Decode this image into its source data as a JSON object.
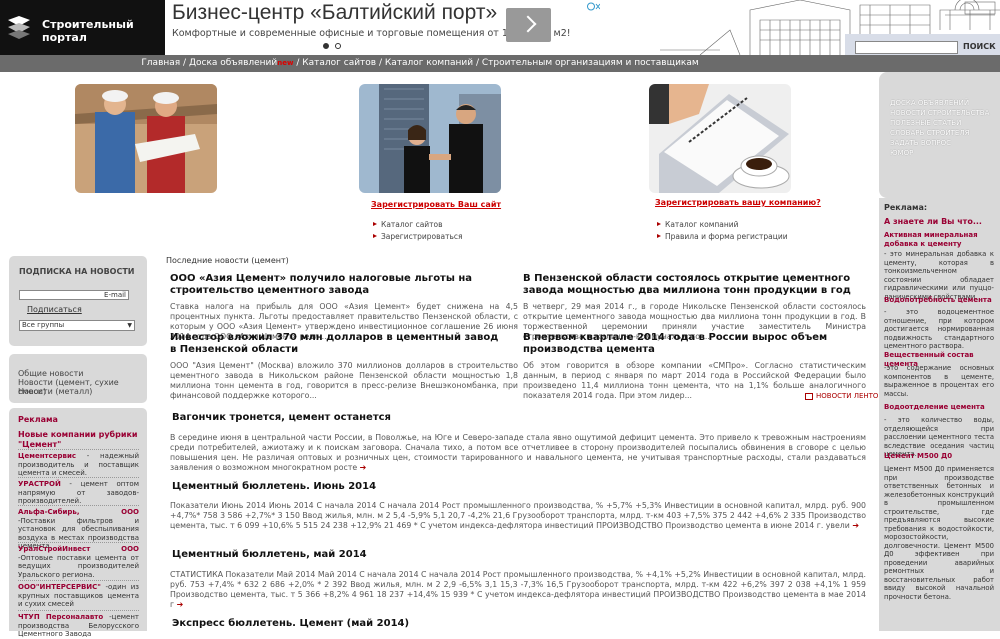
{
  "header": {
    "logo_text": "Строительный портал",
    "ad_title": "Бизнес-центр «Балтийский порт»",
    "ad_subtitle": "Комфортные и современные офисные и торговые помещения от 10 до 250 м2!",
    "search_button": "ПОИСК"
  },
  "nav": {
    "items": [
      "Главная",
      "Доска объявлений",
      "Каталог сайтов",
      "Каталог компаний",
      "Строительным организациям и поставщикам"
    ],
    "new_badge": "new"
  },
  "promo": {
    "sites_title": "Зарегистрировать Ваш сайт",
    "sites_links": [
      "Каталог сайтов",
      "Зарегистрироваться"
    ],
    "company_title": "Зарегистрировать вашу компанию?",
    "company_links": [
      "Каталог компаний",
      "Правила и форма регистрации"
    ]
  },
  "subscribe": {
    "title": "ПОДПИСКА НА НОВОСТИ",
    "email_placeholder": "E-mail",
    "subscribe_link": "Подписаться",
    "group_select": "Все группы"
  },
  "news_groups": [
    "Общие новости",
    "Новости (цемент, сухие смеси)",
    "Новости (металл)"
  ],
  "advert": {
    "title": "Реклама",
    "rubric": "Новые компании рубрики \"Цемент\"",
    "companies": [
      {
        "name": "Цементсервис",
        "text": " - надежный производитель и поставщик цемента и смесей."
      },
      {
        "name": "УРАСТРОЙ",
        "text": " - цемент оптом напрямую от заводов-производителей."
      },
      {
        "name": "Альфа-Сибирь, ООО",
        "text": " -Поставки фильтров и установок для обеспыливания воздуха в местах производства цемента."
      },
      {
        "name": "УралСтройИнвест ООО",
        "text": " -Оптовые поставки цемента от ведущих производителей Уральского региона."
      },
      {
        "name": "ООО\"ИНТЕРСЕРВИС\"",
        "text": " -один из крупных поставщиков цемента и сухих смесей"
      },
      {
        "name": "ЧТУП Персоналавто",
        "text": " -цемент производства Белорусского Цементного Завода"
      }
    ]
  },
  "right_menu": [
    "ДОСКА ОБЪЯВЛЕНИЙ",
    "НОВОСТИ СТРОИТЕЛЬСТВА",
    "ПОЛЕЗНЫЕ СТАТЬИ",
    "СЛОВАРЬ СТРОИТЕЛЯ",
    "ЗАДАТЬ ВОПРОС",
    "ЮМОР"
  ],
  "right_ads": {
    "title": "Реклама:",
    "question": "А знаете ли Вы что...",
    "terms": [
      {
        "term": "Активная минеральная добавка к цементу",
        "def": "- это минеральная добавка к цементу, которая в тонкоизмельченном состоянии обладает гидравлическими или пуццо-ланическими свойствами."
      },
      {
        "term": "Водопотребность цемента",
        "def": "- это водоцементное отношение, при котором достигается нормированная подвижность стандартного цементного раствора."
      },
      {
        "term": "Вещественный состав цемента",
        "def": "-это содержание основных компонентов в цементе, выраженное в процентах его массы."
      },
      {
        "term": "Водоотделение цемента",
        "def": "- это количество воды, отделяющейся при расслоении цементного теста вследствие оседания частиц цемента."
      },
      {
        "term": "Цемент М500 Д0",
        "def": "Цемент М500 Д0 применяется при производстве ответственных бетонных и железобетонных конструкций в промышленном строительстве, где предъявляются высокие требования к водостойкости, морозостойкости, долговечности. Цемент М500 Д0 эффективен при проведении аварийных ремонтных и восстановительных работ ввиду высокой начальной прочности бетона."
      }
    ]
  },
  "latest_label": "Последние новости (цемент)",
  "all_news": "НОВОСТИ ЛЕНТОЙ",
  "news": [
    {
      "title": "ООО «Азия Цемент» получило налоговые льготы на строительство цементного завода",
      "text": "Ставка налога на прибыль для ООО «Азия Цемент» будет снижена на 4,5 процентных пункта. Льготы предоставляет правительство Пензенской области, с которым у ООО «Азия Цемент» утверждено инвестиционное соглашение 26 июня 2014 года ООО «Азия Цемент» реал..."
    },
    {
      "title": "В Пензенской области состоялось открытие цементного завода мощностью два миллиона тонн продукции в год",
      "text": "В четверг, 29 мая 2014 г., в городе Никольске Пензенской области состоялось открытие цементного завода мощностью два миллиона тонн продукции в год. В торжественной церемонии приняли участие заместитель Министра строительства и жилищно-коммунального ..."
    },
    {
      "title": "Инвестор вложил 370 млн долларов в цементный завод в Пензенской области",
      "text": "ООО \"Азия Цемент\" (Москва) вложило 370 миллионов долларов в строительство цементного завода в Никольском районе Пензенской области мощностью 1,8 миллиона тонн цемента в год, говорится в пресс-релизе Внешэкономбанка, при финансовой поддержке которого..."
    },
    {
      "title": "В первом квартале 2014 года в России вырос объем производства цемента",
      "text": "Об этом говорится в обзоре компании «СМПро». Согласно статистическим данным, в период с января по март 2014 года в Российской Федерации было произведено 11,4 миллиона тонн цемента, что на 1,1% больше аналогичного показателя 2014 года. При этом лидер..."
    }
  ],
  "articles": [
    {
      "title": "Вагончик тронется, цемент останется",
      "text": "В середине июня в центральной части России, в Поволжье, на Юге и Северо-западе стала явно ощутимой дефицит цемента. Это привело к тревожным настроениям среди потребителей, ажиотажу и к поискам заговора. Сначала тихо, а потом все отчетливее в сторону производителей посыпались обвинения в сговоре с целью повышения цен. Не различая оптовых и розничных цен, стоимости тарированного и навального цемента, не учитывая транспортные расходы, стали раздаваться заявления о возможном многократном росте"
    },
    {
      "title": "Цементный бюллетень. Июнь 2014",
      "text": "Показатели Июнь 2014 Июнь 2014 С начала 2014 С начала 2014 Рост промышленного производства, %    +5,7%        +5,3%    Инвестиции в основной капитал, млрд. руб. 900 +4,7%* 758 3 586 +2,7%* 3 150 Ввод жилья, млн. м 2 5,4 -5,9% 5,1 20,7 -4,2% 21,6 Грузооборот транспорта, млрд. т-км 403 +7,5% 375 2 442 +4,6% 2 335 Производство цемента, тыс. т 6 099 +10,6% 5 515 24 238 +12,9% 21 469 * С учетом индекса-дефлятора инвестиций ПРОИЗВОДСТВО Производство цемента в июне 2014 г. увели"
    },
    {
      "title": "Цементный бюллетень, май 2014",
      "text": "СТАТИСТИКА Показатели Май 2014 Май 2014 С начала 2014 С начала 2014 Рост промышленного производства, %    +4,1%        +5,2%    Инвестиции в основной капитал, млрд. руб. 753 +7,4% * 632 2 686 +2,0% * 2 392 Ввод жилья, млн. м 2 2,9 -6,5% 3,1 15,3 -7,3% 16,5 Грузооборот транспорта, млрд. т-км 422 +6,2% 397 2 038 +4,1% 1 959 Производство цемента, тыс. т 5 366 +8,2% 4 961 18 237 +14,4% 15 939 * С учетом индекса-дефлятора инвестиций ПРОИЗВОДСТВО Производство цемента в мае 2014 г"
    },
    {
      "title": "Экспресс бюллетень. Цемент (май 2014)",
      "text": ""
    }
  ]
}
